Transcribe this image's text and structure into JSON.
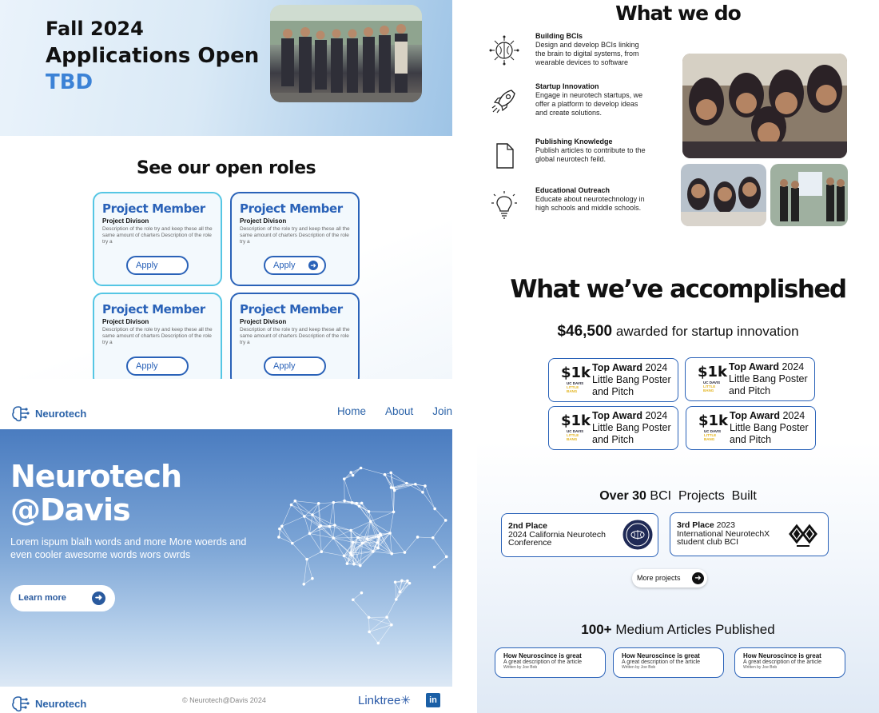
{
  "applications": {
    "season": "Fall 2024",
    "status": "Applications Open",
    "date": "TBD"
  },
  "roles": {
    "heading": "See our open roles",
    "cards": [
      {
        "title": "Project Member",
        "division": "Project Divison",
        "description": "Description of the role try and keep these all the same amount of charters Description of the role try a",
        "button": "Apply"
      },
      {
        "title": "Project Member",
        "division": "Project Divison",
        "description": "Description of the role try and keep these all the same amount of charters Description of the role try a",
        "button": "Apply"
      },
      {
        "title": "Project Member",
        "division": "Project Divison",
        "description": "Description of the role try and keep these all the same amount of charters Description of the role try a",
        "button": "Apply"
      },
      {
        "title": "Project Member",
        "division": "Project Divison",
        "description": "Description of the role try and keep these all the same amount of charters Description of the role try a",
        "button": "Apply"
      }
    ]
  },
  "home": {
    "brand": "Neurotech",
    "nav": [
      "Home",
      "About",
      "Join"
    ],
    "hero_title_line1": "Neurotech",
    "hero_title_line2": "@Davis",
    "hero_description": "Lorem ispum blalh words and more More woerds and even cooler awesome words wors owrds",
    "cta": "Learn more",
    "footer_copyright": "Neurotech@Davis 2024",
    "footer_linktree": "Linktree",
    "footer_linkedin": "in"
  },
  "what_we_do": {
    "heading": "What we do",
    "items": [
      {
        "title": "Building BCIs",
        "description": "Design and develop BCIs linking the brain to digital systems, from wearable devices to software",
        "icon": "brain-circuit-icon"
      },
      {
        "title": "Startup Innovation",
        "description": "Engage in neurotech startups, we offer a platform to develop ideas and create solutions.",
        "icon": "rocket-icon"
      },
      {
        "title": "Publishing Knowledge",
        "description": "Publish articles to contribute to the global neurotech feild.",
        "icon": "document-icon"
      },
      {
        "title": "Educational Outreach",
        "description": "Educate about neurotechnology in high schools and middle schools.",
        "icon": "lightbulb-icon"
      }
    ]
  },
  "accomplished": {
    "heading": "What we’ve accomplished",
    "awarded_amount": "$46,500",
    "awarded_text": "awarded for startup innovation",
    "awards": [
      {
        "amount": "$1k",
        "title": "Top Award",
        "year": "2024",
        "event": "Little Bang Poster and Pitch",
        "logo_top": "UC DAVIS",
        "logo_bottom": "LITTLE BANG"
      },
      {
        "amount": "$1k",
        "title": "Top Award",
        "year": "2024",
        "event": "Little Bang Poster and Pitch",
        "logo_top": "UC DAVIS",
        "logo_bottom": "LITTLE BANG"
      },
      {
        "amount": "$1k",
        "title": "Top Award",
        "year": "2024",
        "event": "Little Bang Poster and Pitch",
        "logo_top": "UC DAVIS",
        "logo_bottom": "LITTLE BANG"
      },
      {
        "amount": "$1k",
        "title": "Top Award",
        "year": "2024",
        "event": "Little Bang Poster and Pitch",
        "logo_top": "UC DAVIS",
        "logo_bottom": "LITTLE BANG"
      }
    ],
    "projects_count": "Over 30",
    "projects_text": "BCI  Projects  Built",
    "placements": [
      {
        "place": "2nd Place",
        "year": "",
        "event": "2024 California Neurotech Conference"
      },
      {
        "place": "3rd Place",
        "year": "2023",
        "event": "International NeurotechX student club BCI"
      }
    ],
    "more_projects": "More projects",
    "articles_count": "100+",
    "articles_text": "Medium Articles Published",
    "articles": [
      {
        "title": "How Neuroscince is great",
        "description": "A great description of the article",
        "author": "Written by Joe Bob"
      },
      {
        "title": "How Neuroscince is great",
        "description": "A great description of the article",
        "author": "Written by Joe Bob"
      },
      {
        "title": "How Neuroscince is great",
        "description": "A great description of the article",
        "author": "Written by Joe Bob"
      }
    ]
  },
  "colors": {
    "brand_blue": "#2a62b8",
    "accent_cyan": "#55c6e4",
    "tbd_blue": "#3b82d6"
  }
}
